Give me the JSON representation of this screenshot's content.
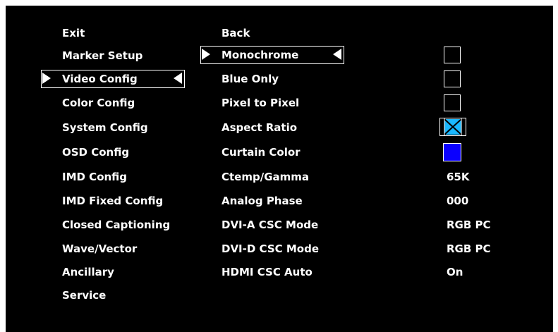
{
  "left_menu": {
    "items": [
      "Exit",
      "Marker Setup",
      "Video Config",
      "Color Config",
      "System Config",
      "OSD Config",
      "IMD Config",
      "IMD Fixed Config",
      "Closed Captioning",
      "Wave/Vector",
      "Ancillary",
      "Service"
    ],
    "selected": "Video Config"
  },
  "video_config": {
    "back_label": "Back",
    "items": [
      {
        "label": "Monochrome",
        "type": "checkbox",
        "checked": false
      },
      {
        "label": "Blue Only",
        "type": "checkbox",
        "checked": false
      },
      {
        "label": "Pixel to Pixel",
        "type": "checkbox",
        "checked": false
      },
      {
        "label": "Aspect Ratio",
        "type": "aspect-icon",
        "value_icon": "aspect-ratio-icon"
      },
      {
        "label": "Curtain Color",
        "type": "color-swatch",
        "color": "#0a00ff"
      },
      {
        "label": "Ctemp/Gamma",
        "type": "value",
        "value": "65K"
      },
      {
        "label": "Analog Phase",
        "type": "value",
        "value": "000"
      },
      {
        "label": "DVI-A CSC Mode",
        "type": "value",
        "value": "RGB PC"
      },
      {
        "label": "DVI-D CSC Mode",
        "type": "value",
        "value": "RGB PC"
      },
      {
        "label": "HDMI CSC Auto",
        "type": "value",
        "value": "On"
      }
    ],
    "selected": "Monochrome"
  },
  "colors": {
    "background": "#000000",
    "text": "#ffffff",
    "aspect_accent": "#1bb8ff",
    "curtain": "#0a00ff"
  }
}
